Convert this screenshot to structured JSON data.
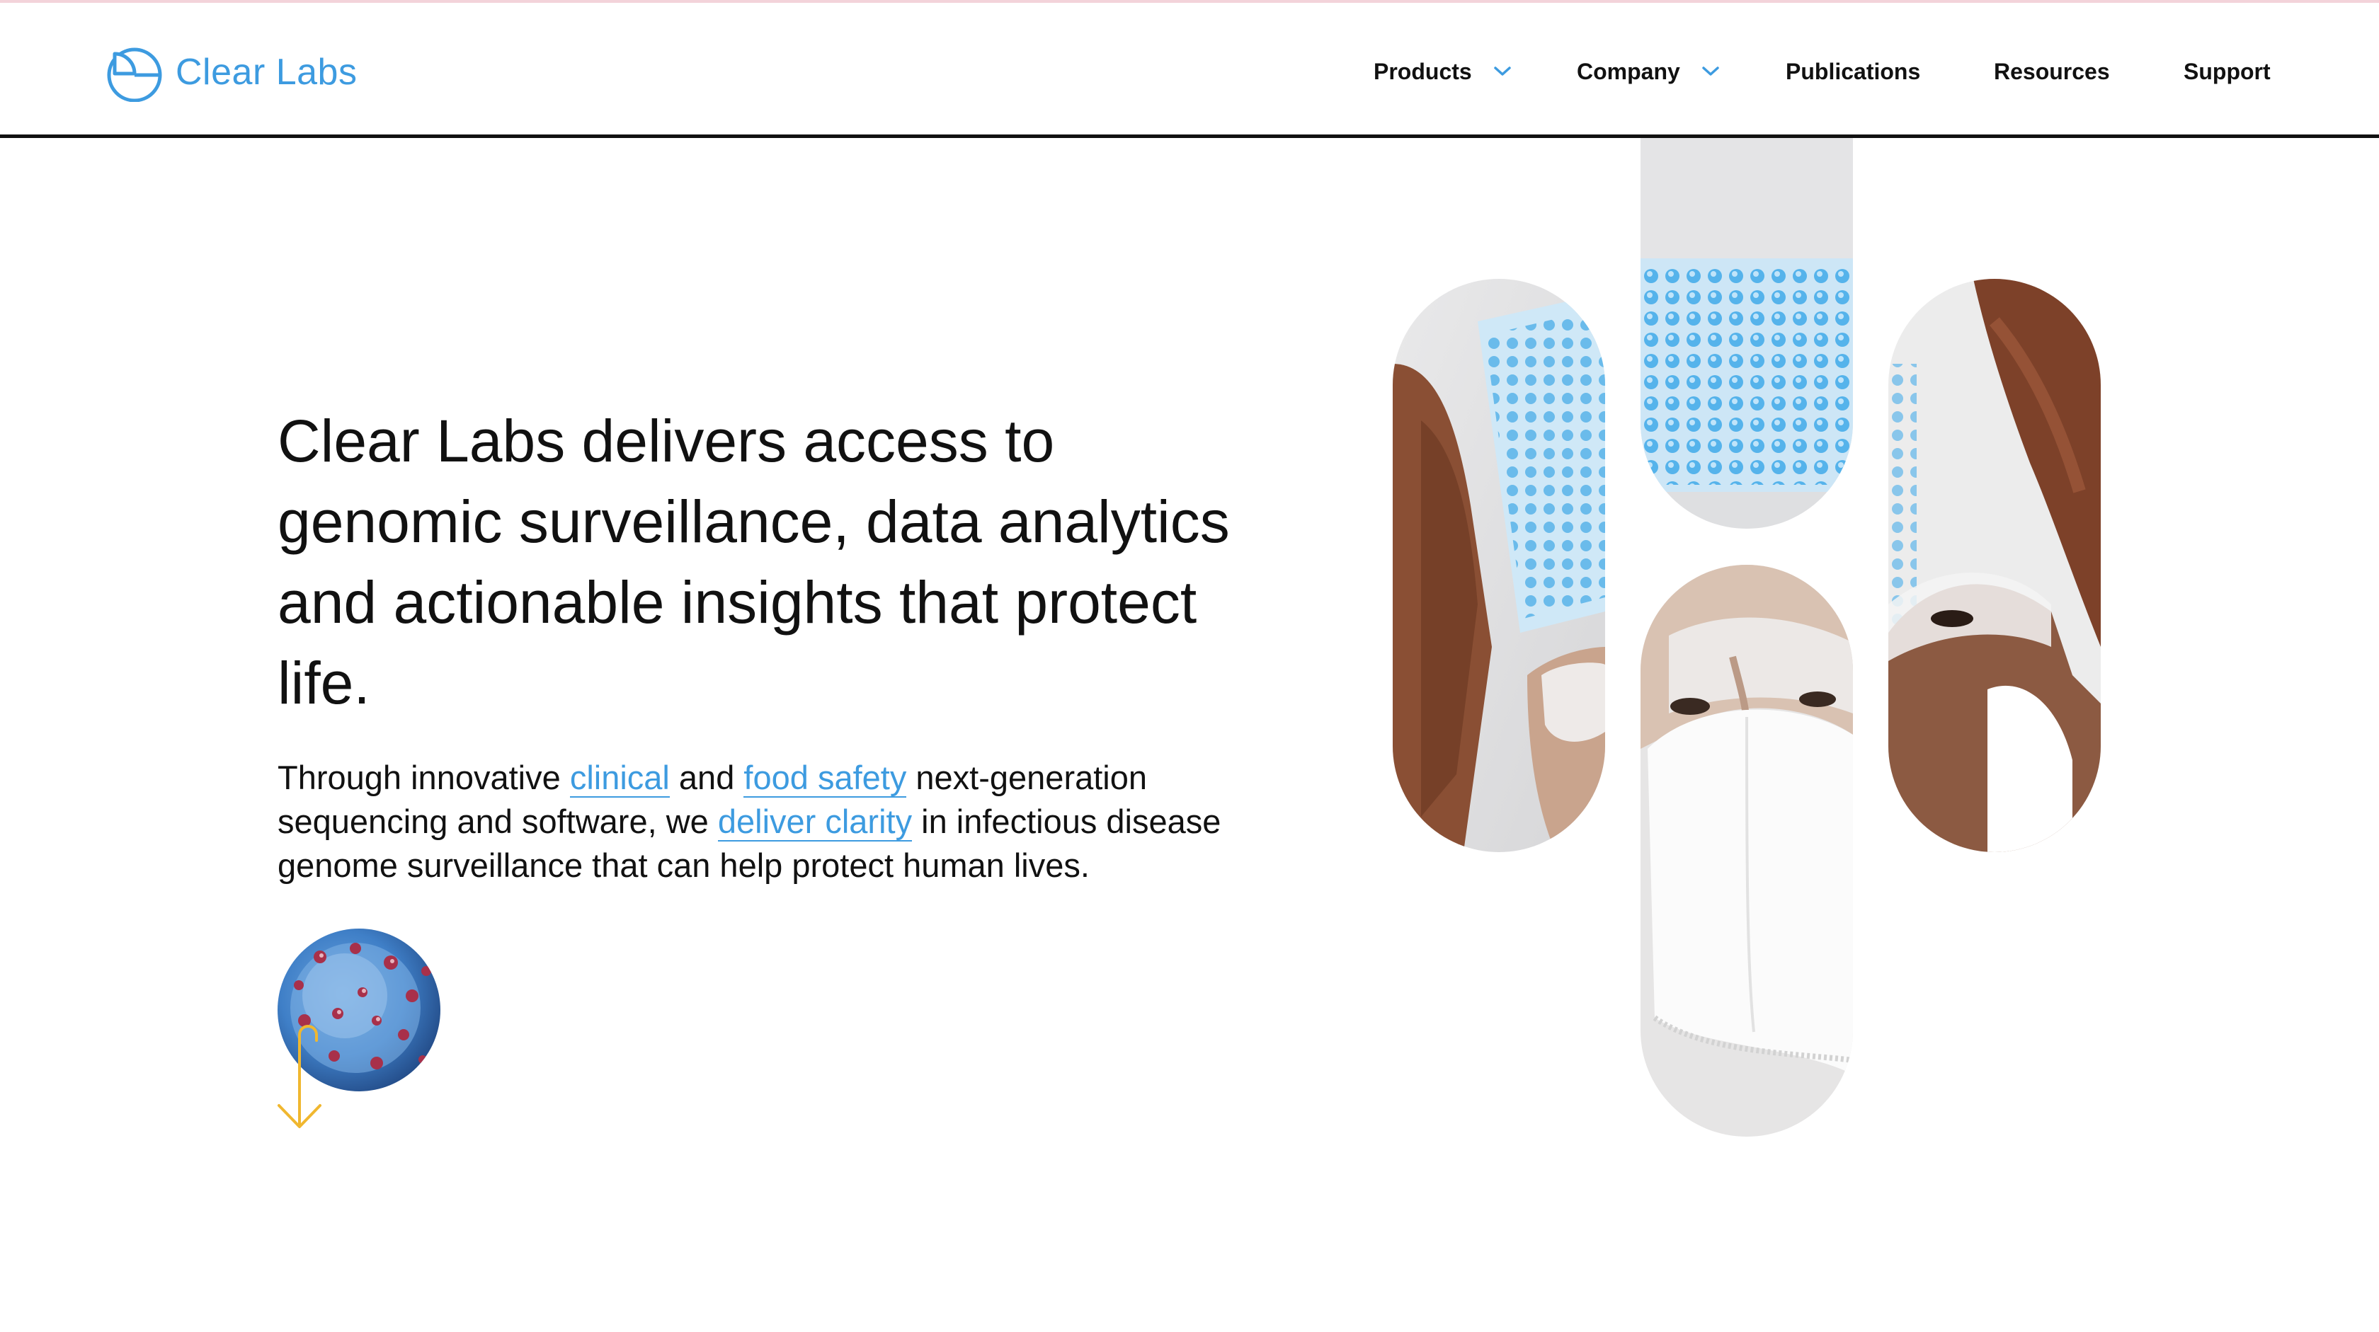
{
  "brand": {
    "name": "Clear Labs",
    "accent_color": "#3d9be0",
    "logo_icon": "clear-labs-logo-icon"
  },
  "nav": {
    "items": [
      {
        "label": "Products",
        "has_dropdown": true
      },
      {
        "label": "Company",
        "has_dropdown": true
      },
      {
        "label": "Publications",
        "has_dropdown": false
      },
      {
        "label": "Resources",
        "has_dropdown": false
      },
      {
        "label": "Support",
        "has_dropdown": false
      }
    ],
    "dropdown_icon": "chevron-down-icon"
  },
  "hero": {
    "headline": "Clear Labs delivers access to genomic surveillance, data analytics and actionable insights that protect life.",
    "body": {
      "part1": "Through innovative ",
      "link_clinical": "clinical",
      "part2": " and ",
      "link_food_safety": "food safety",
      "part3": " next-generation sequencing and software, we ",
      "link_deliver_clarity": "deliver clarity",
      "part4": " in infectious disease genome surveillance that can help protect human lives."
    },
    "scroll_icon": "arrow-down-icon",
    "scroll_icon_color": "#f0b72f"
  },
  "images": [
    {
      "name": "lab-photo-hands-plate",
      "subject": "hands holding sample plate"
    },
    {
      "name": "lab-photo-sample-plate",
      "subject": "blue sample plate close-up"
    },
    {
      "name": "lab-photo-masked-scientist",
      "subject": "scientist in goggles and mask"
    },
    {
      "name": "lab-photo-scientist-side",
      "subject": "scientist with goggles holding plate"
    },
    {
      "name": "virus-illustration",
      "subject": "virus particle"
    }
  ]
}
